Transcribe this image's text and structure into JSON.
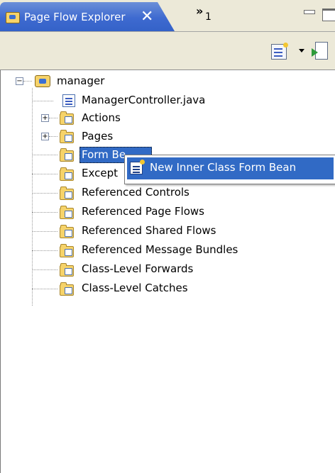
{
  "view": {
    "tab_title": "Page Flow Explorer",
    "close_glyph": "✕",
    "overflow_glyph": "»",
    "overflow_count": "1"
  },
  "toolbar": {
    "buttons": [
      "new-element-icon",
      "dropdown-arrow-icon",
      "run-icon"
    ]
  },
  "tree": {
    "root": {
      "label": "manager",
      "expanded": true,
      "icon": "page-flow-folder-icon"
    },
    "children": [
      {
        "label": "ManagerController.java",
        "icon": "java-file-icon",
        "expandable": false
      },
      {
        "label": "Actions",
        "icon": "actions-folder-icon",
        "expandable": true,
        "toggle": "+"
      },
      {
        "label": "Pages",
        "icon": "pages-folder-icon",
        "expandable": true,
        "toggle": "+"
      },
      {
        "label": "Form Beans",
        "visible_label": "Form Be",
        "icon": "form-beans-folder-icon",
        "selected": true
      },
      {
        "label": "Exceptions",
        "visible_label": "Except",
        "icon": "exceptions-folder-icon"
      },
      {
        "label": "Referenced Controls",
        "icon": "controls-folder-icon"
      },
      {
        "label": "Referenced Page Flows",
        "icon": "page-flows-folder-icon"
      },
      {
        "label": "Referenced Shared Flows",
        "icon": "shared-flows-folder-icon"
      },
      {
        "label": "Referenced Message Bundles",
        "icon": "message-bundles-folder-icon"
      },
      {
        "label": "Class-Level Forwards",
        "icon": "forwards-folder-icon"
      },
      {
        "label": "Class-Level Catches",
        "icon": "catches-folder-icon"
      }
    ]
  },
  "context_menu": {
    "items": [
      {
        "label": "New Inner Class Form Bean",
        "icon": "new-form-bean-icon"
      }
    ]
  },
  "colors": {
    "tab_active": "#3e6ad0",
    "selection": "#316ac5",
    "folder": "#f6d36a",
    "chrome": "#ece9d8"
  }
}
